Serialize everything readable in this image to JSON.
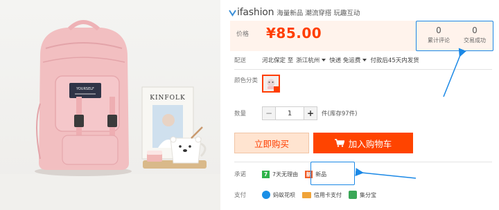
{
  "brand": {
    "name": "ifashion",
    "slogan": "海量新品 潮流穿搭 玩趣互动"
  },
  "price": {
    "label": "价格",
    "value": "¥85.00"
  },
  "stats": [
    {
      "count": "0",
      "label": "累计评论"
    },
    {
      "count": "0",
      "label": "交易成功"
    }
  ],
  "shipping": {
    "label": "配送",
    "origin": "河北保定 至",
    "destination": "浙江杭州",
    "method": "快递 免运费",
    "dispatch": "付款后45天内发货"
  },
  "color": {
    "label": "颜色分类"
  },
  "quantity": {
    "label": "数量",
    "minus": "−",
    "value": "1",
    "plus": "+",
    "stock": "件(库存97件)"
  },
  "actions": {
    "buy": "立即购买",
    "cart": "加入购物车"
  },
  "promise": {
    "label": "承诺",
    "items": [
      {
        "badge": "7",
        "text": "7天无理由",
        "color": "#2fb34a"
      },
      {
        "badge": "新",
        "text": "新品",
        "color": "#f15a24"
      }
    ]
  },
  "payment": {
    "label": "支付",
    "items": [
      {
        "text": "蚂蚁花呗"
      },
      {
        "text": "信用卡支付"
      },
      {
        "text": "集分宝"
      }
    ]
  },
  "product_photo": {
    "book_title": "KINFOLK",
    "patch_text": "YOURSELF"
  },
  "colors": {
    "accent": "#ff4400",
    "price": "#ff3d00",
    "highlight": "#1a88e6",
    "panel": "#fff3ec"
  }
}
